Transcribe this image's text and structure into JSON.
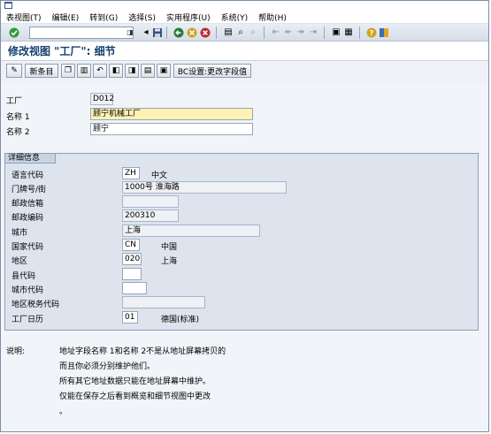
{
  "menubar": {
    "items": [
      "表视图(T)",
      "编辑(E)",
      "转到(G)",
      "选择(S)",
      "实用程序(U)",
      "系统(Y)",
      "帮助(H)"
    ]
  },
  "toolbar": {
    "icons": [
      "enter-icon",
      "save-icon",
      "back-icon",
      "exit-icon",
      "cancel-icon",
      "print-icon",
      "find-icon",
      "first-page-icon",
      "help-icon",
      "layout-icon"
    ]
  },
  "title": "修改视图 \"工厂\": 细节",
  "app_toolbar": {
    "new_entries": "新条目",
    "bc_set": "BC设置:更改字段值"
  },
  "header_fields": {
    "plant_label": "工厂",
    "plant_value": "D012",
    "name1_label": "名称 1",
    "name1_value": "顾宁机械工厂",
    "name2_label": "名称 2",
    "name2_value": "顾宁"
  },
  "detail": {
    "group_title": "详细信息",
    "language_label": "语言代码",
    "language_value": "ZH",
    "language_text": "中文",
    "street_label": "门牌号/街",
    "street_value": "1000号 淮海路",
    "pobox_label": "邮政信箱",
    "pobox_value": "",
    "postal_label": "邮政编码",
    "postal_value": "200310",
    "city_label": "城市",
    "city_value": "上海",
    "country_label": "国家代码",
    "country_value": "CN",
    "country_text": "中国",
    "region_label": "地区",
    "region_value": "020",
    "region_text": "上海",
    "county_label": "县代码",
    "county_value": "",
    "citycode_label": "城市代码",
    "citycode_value": "",
    "taxjur_label": "地区税务代码",
    "taxjur_value": "",
    "calendar_label": "工厂日历",
    "calendar_value": "01",
    "calendar_text": "德国(标准)"
  },
  "note": {
    "label": "说明:",
    "lines": [
      "地址字段名称 1和名称 2不是从地址屏幕拷贝的",
      "而且你必须分别维护他们。",
      "所有其它地址数据只能在地址屏幕中维护。",
      "仅能在保存之后看到概览和细节视图中更改",
      "。"
    ]
  }
}
